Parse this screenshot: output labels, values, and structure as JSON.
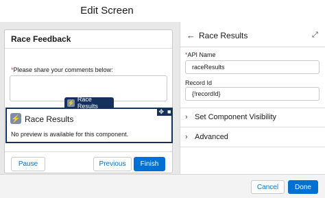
{
  "header": {
    "title": "Edit Screen"
  },
  "screen": {
    "card_title": "Race Feedback",
    "question": {
      "required_mark": "*",
      "label": "Please share your comments below:",
      "value": ""
    },
    "component_tab_label": "Race Results",
    "component": {
      "name": "Race Results",
      "preview_text": "No preview is available for this component.",
      "tool_icons": [
        "move-icon",
        "trash-icon"
      ]
    },
    "buttons": {
      "pause": "Pause",
      "previous": "Previous",
      "finish": "Finish"
    }
  },
  "properties": {
    "title": "Race Results",
    "fields": [
      {
        "required_mark": "*",
        "label": "API Name",
        "value": "raceResults"
      },
      {
        "required_mark": "",
        "label": "Record Id",
        "value": "{!recordId}"
      }
    ],
    "sections": [
      {
        "label": "Set Component Visibility"
      },
      {
        "label": "Advanced"
      }
    ]
  },
  "footer": {
    "cancel": "Cancel",
    "done": "Done"
  },
  "colors": {
    "brand": "#0070d2",
    "selection": "#16325c",
    "required": "#c23934"
  }
}
